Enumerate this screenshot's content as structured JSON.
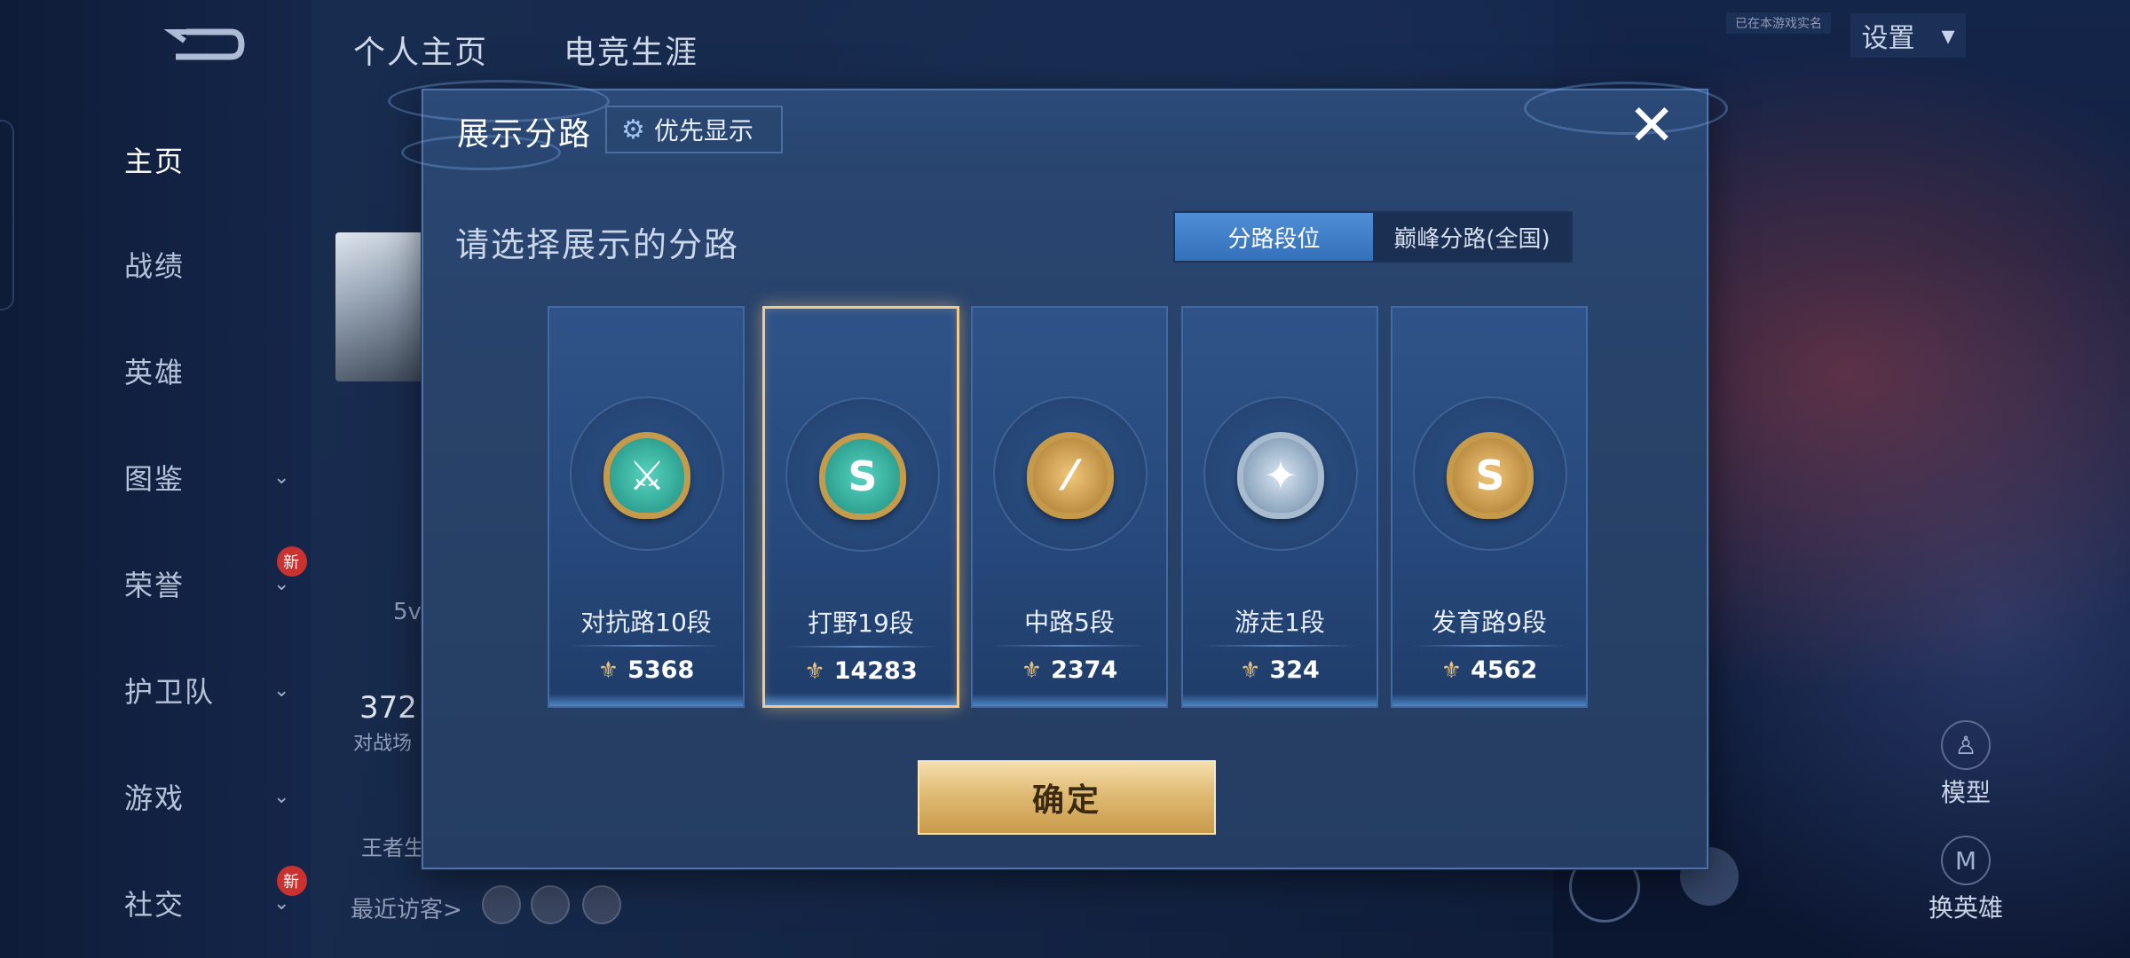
{
  "nav": {
    "items": [
      {
        "label": "主页",
        "active": true,
        "chevron": false,
        "badge": ""
      },
      {
        "label": "战绩",
        "active": false,
        "chevron": false,
        "badge": ""
      },
      {
        "label": "英雄",
        "active": false,
        "chevron": false,
        "badge": ""
      },
      {
        "label": "图鉴",
        "active": false,
        "chevron": true,
        "badge": ""
      },
      {
        "label": "荣誉",
        "active": false,
        "chevron": true,
        "badge": "新"
      },
      {
        "label": "护卫队",
        "active": false,
        "chevron": true,
        "badge": ""
      },
      {
        "label": "游戏",
        "active": false,
        "chevron": true,
        "badge": ""
      },
      {
        "label": "社交",
        "active": false,
        "chevron": true,
        "badge": "新"
      }
    ]
  },
  "header": {
    "tabs": [
      "个人主页",
      "电竞生涯"
    ],
    "settings_label": "设置",
    "tiny_tag": "已在本游戏实名"
  },
  "background": {
    "partial_texts": [
      "5v",
      "372",
      "对战场",
      "王者生"
    ],
    "recent_visitors_label": "最近访客>"
  },
  "side_actions": {
    "model_label": "模型",
    "change_hero_label": "换英雄"
  },
  "modal": {
    "title": "展示分路",
    "priority_label": "优先显示",
    "close_symbol": "✕",
    "subtitle": "请选择展示的分路",
    "segments": [
      {
        "label": "分路段位",
        "active": true
      },
      {
        "label": "巅峰分路(全国)",
        "active": false
      }
    ],
    "lanes": [
      {
        "name": "对抗路10段",
        "score": "5368",
        "selected": false,
        "emblem": "sword-shield-icon",
        "glyph": "⚔",
        "style": "teal"
      },
      {
        "name": "打野19段",
        "score": "14283",
        "selected": true,
        "emblem": "dragon-icon",
        "glyph": "S",
        "style": "teal"
      },
      {
        "name": "中路5段",
        "score": "2374",
        "selected": false,
        "emblem": "staff-icon",
        "glyph": "⁄",
        "style": "gold"
      },
      {
        "name": "游走1段",
        "score": "324",
        "selected": false,
        "emblem": "wings-icon",
        "glyph": "✦",
        "style": "silver"
      },
      {
        "name": "发育路9段",
        "score": "4562",
        "selected": false,
        "emblem": "arrow-icon",
        "glyph": "S",
        "style": "gold"
      }
    ],
    "confirm_label": "确定"
  }
}
